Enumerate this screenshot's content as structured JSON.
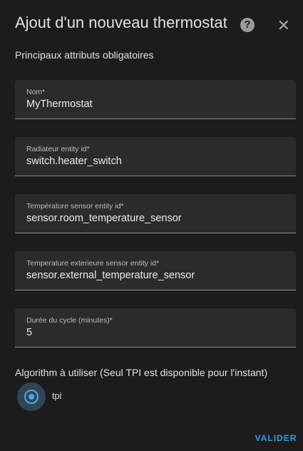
{
  "dialog": {
    "title": "Ajout d'un nouveau thermostat",
    "help_icon": "help-circle-icon",
    "close_icon": "close-icon",
    "section_label": "Principaux attributs obligatoires"
  },
  "fields": [
    {
      "label": "Nom*",
      "value": "MyThermostat"
    },
    {
      "label": "Radiateur entity id*",
      "value": "switch.heater_switch"
    },
    {
      "label": "Température sensor entity id*",
      "value": "sensor.room_temperature_sensor"
    },
    {
      "label": "Temperature exterieure sensor entity id*",
      "value": "sensor.external_temperature_sensor"
    },
    {
      "label": "Durée du cycle (minutes)*",
      "value": "5"
    }
  ],
  "algorithm": {
    "label": "Algorithm à utiliser (Seul TPI est disponible pour l'instant)",
    "options": [
      {
        "label": "tpi",
        "selected": true
      }
    ]
  },
  "actions": {
    "submit_label": "VALIDER"
  },
  "colors": {
    "background": "#1c1c1c",
    "field_background": "#2b2b2b",
    "accent": "#2d9ce8",
    "text": "#e1e1e1"
  }
}
